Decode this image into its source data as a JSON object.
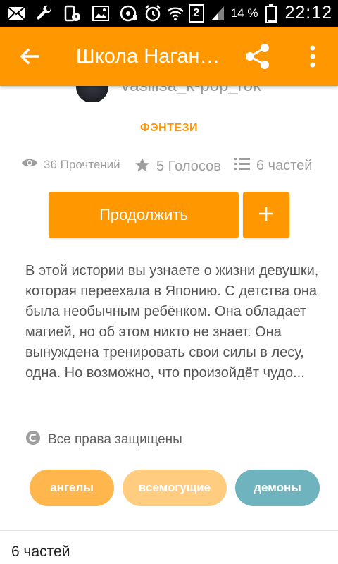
{
  "status_bar": {
    "battery_text": "14 %",
    "sim_label": "2",
    "time": "22:12",
    "icons": [
      "mail-icon",
      "wrench-icon",
      "phone-clock-icon",
      "image-icon",
      "disc-icon",
      "alarm-icon",
      "wifi-icon",
      "signal-icon",
      "battery-icon"
    ]
  },
  "appbar": {
    "title": "Школа Наганских",
    "color": "#ff9800",
    "icons": [
      "back-arrow-icon",
      "share-icon",
      "more-vert-icon"
    ]
  },
  "author": {
    "name": "Vasilisa_k-pop_rok"
  },
  "genre": "ФЭНТЕЗИ",
  "stats": {
    "reads": "36 Прочтений",
    "votes": "5 Голосов",
    "parts": "6 частей"
  },
  "actions": {
    "continue_label": "Продолжить",
    "add_label": "+"
  },
  "description": "В этой истории вы узнаете о жизни девушки, которая переехала в Японию. С детства она была необычным ребёнком. Она обладает магией, но об этом никто не знает. Она вынуждена тренировать свои силы в лесу, одна. Но возможно, что произойдёт чудо...",
  "copyright": "Все права защищены",
  "tags": [
    {
      "label": "ангелы",
      "color": "#ffb74d"
    },
    {
      "label": "всемогущие",
      "color": "#ffcc80"
    },
    {
      "label": "демоны",
      "color": "#6fb3bf"
    }
  ],
  "parts_section": {
    "label": "6 частей"
  }
}
